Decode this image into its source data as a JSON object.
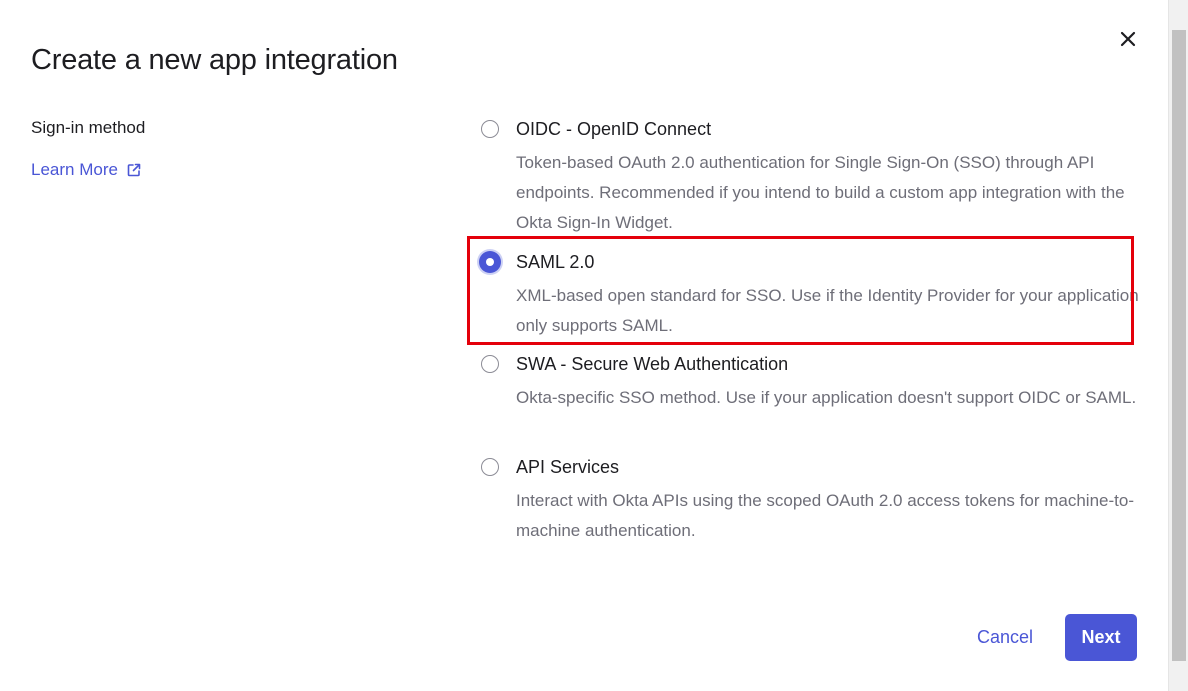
{
  "dialog": {
    "title": "Create a new app integration",
    "close_icon": "close-icon"
  },
  "sidebar": {
    "label": "Sign-in method",
    "learn_more": "Learn More",
    "learn_more_icon": "external-link-icon"
  },
  "options": [
    {
      "label": "OIDC - OpenID Connect",
      "description": "Token-based OAuth 2.0 authentication for Single Sign-On (SSO) through API endpoints. Recommended if you intend to build a custom app integration with the Okta Sign-In Widget.",
      "selected": false
    },
    {
      "label": "SAML 2.0",
      "description": "XML-based open standard for SSO. Use if the Identity Provider for your application only supports SAML.",
      "selected": true
    },
    {
      "label": "SWA - Secure Web Authentication",
      "description": "Okta-specific SSO method. Use if your application doesn't support OIDC or SAML.",
      "selected": false
    },
    {
      "label": "API Services",
      "description": "Interact with Okta APIs using the scoped OAuth 2.0 access tokens for machine-to-machine authentication.",
      "selected": false
    }
  ],
  "footer": {
    "cancel_label": "Cancel",
    "next_label": "Next"
  },
  "colors": {
    "accent": "#4a56d6",
    "highlight": "#e4000b",
    "text": "#1d1d21",
    "muted_text": "#6e6e78"
  }
}
